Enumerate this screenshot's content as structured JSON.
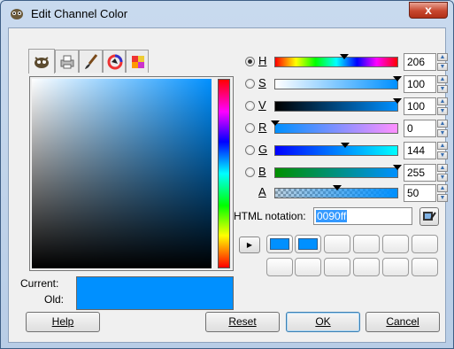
{
  "window": {
    "title": "Edit Channel Color",
    "close_glyph": "x"
  },
  "tabs": [
    {
      "icon": "gimp-icon",
      "active": true
    },
    {
      "icon": "printer-icon",
      "active": false
    },
    {
      "icon": "brush-icon",
      "active": false
    },
    {
      "icon": "color-wheel-icon",
      "active": false
    },
    {
      "icon": "palette-icon",
      "active": false
    }
  ],
  "swatches": {
    "current_label": "Current:",
    "old_label": "Old:",
    "current_color": "#0090ff",
    "old_color": "#0090ff"
  },
  "channels": [
    {
      "key": "H",
      "label": "H",
      "value": "206",
      "selected": true
    },
    {
      "key": "S",
      "label": "S",
      "value": "100",
      "selected": false
    },
    {
      "key": "V",
      "label": "V",
      "value": "100",
      "selected": false
    },
    {
      "key": "R",
      "label": "R",
      "value": "0",
      "selected": false
    },
    {
      "key": "G",
      "label": "G",
      "value": "144",
      "selected": false
    },
    {
      "key": "B",
      "label": "B",
      "value": "255",
      "selected": false
    },
    {
      "key": "A",
      "label": "A",
      "value": "50",
      "selected": false
    }
  ],
  "html_notation": {
    "label": "HTML notation:",
    "value": "0090ff"
  },
  "history": {
    "filled_count": 2,
    "total": 12
  },
  "buttons": {
    "help": "Help",
    "reset": "Reset",
    "ok": "OK",
    "cancel": "Cancel"
  },
  "colors": {
    "accent": "#0090ff",
    "selection": "#3399ff"
  }
}
